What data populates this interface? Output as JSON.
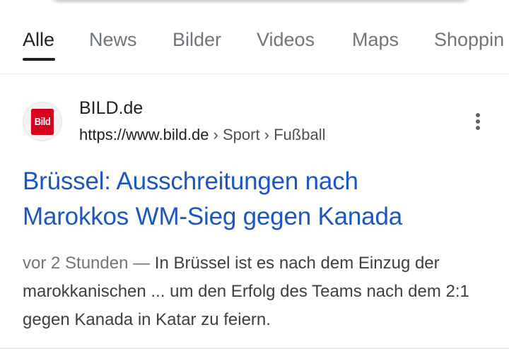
{
  "tabs": [
    {
      "label": "Alle",
      "active": true
    },
    {
      "label": "News",
      "active": false
    },
    {
      "label": "Bilder",
      "active": false
    },
    {
      "label": "Videos",
      "active": false
    },
    {
      "label": "Maps",
      "active": false
    },
    {
      "label": "Shoppin",
      "active": false
    }
  ],
  "result": {
    "favicon_text": "Bild",
    "favicon_color": "#d8001c",
    "site_name": "BILD.de",
    "url": "https://www.bild.de",
    "breadcrumb": " › Sport › Fußball",
    "title_line1": "Brüssel: Ausschreitungen nach",
    "title_line2": "Marokkos WM-Sieg gegen Kanada",
    "date": "vor 2 Stunden",
    "separator": " — ",
    "snippet": "In Brüssel ist es nach dem Einzug der marokkanischen ... um den Erfolg des Teams nach dem 2:1 gegen Kanada in Katar zu feiern.",
    "more_icon": "more-vert-icon"
  },
  "colors": {
    "link": "#1a57c4",
    "text": "#202124",
    "muted": "#70757a"
  }
}
